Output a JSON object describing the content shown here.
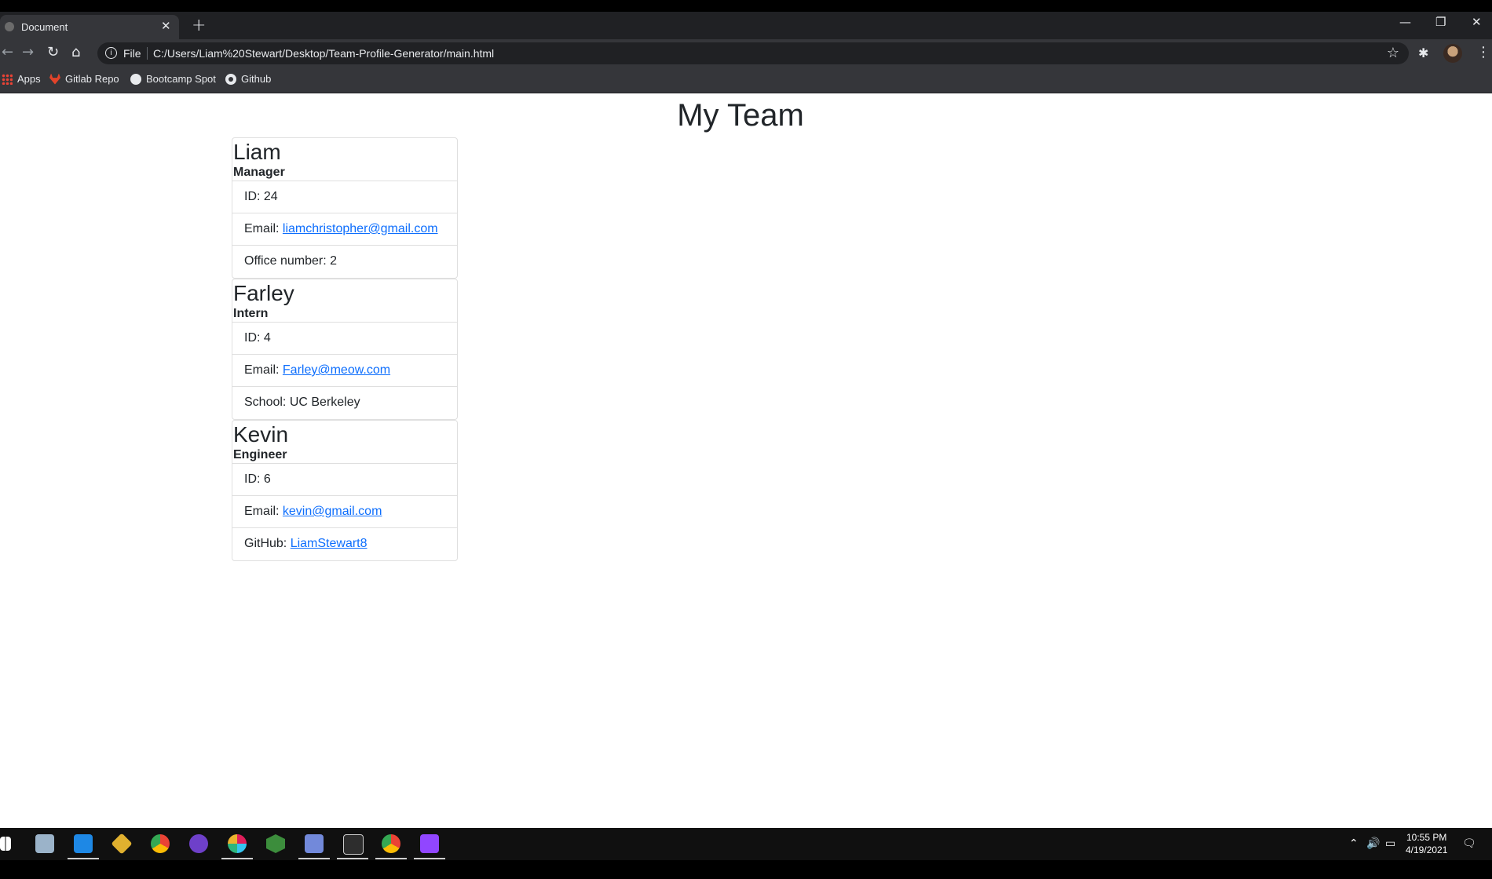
{
  "browser": {
    "tab_title": "Document",
    "close_glyph": "✕",
    "new_tab_glyph": "+",
    "url_scheme": "File",
    "url": "C:/Users/Liam%20Stewart/Desktop/Team-Profile-Generator/main.html",
    "bookmarks": [
      {
        "label": "Apps",
        "icon": "apps-icon"
      },
      {
        "label": "Gitlab Repo",
        "icon": "gitlab-icon"
      },
      {
        "label": "Bootcamp Spot",
        "icon": "globe-icon"
      },
      {
        "label": "Github",
        "icon": "github-icon"
      }
    ]
  },
  "page": {
    "title": "My Team",
    "members": [
      {
        "name": "Liam",
        "role": "Manager",
        "id_label": "ID: 24",
        "email_prefix": "Email: ",
        "email": "liamchristopher@gmail.com",
        "extra_prefix": "Office number: 2",
        "extra_link": ""
      },
      {
        "name": "Farley",
        "role": "Intern",
        "id_label": "ID: 4",
        "email_prefix": "Email: ",
        "email": "Farley@meow.com",
        "extra_prefix": "School: UC Berkeley",
        "extra_link": ""
      },
      {
        "name": "Kevin",
        "role": "Engineer",
        "id_label": "ID: 6",
        "email_prefix": "Email: ",
        "email": "kevin@gmail.com",
        "extra_prefix": "GitHub: ",
        "extra_link": "LiamStewart8"
      }
    ]
  },
  "taskbar": {
    "time": "10:55 PM",
    "date": "4/19/2021"
  },
  "colors": {
    "link": "#0d6efd",
    "chrome_dark": "#202124",
    "chrome_toolbar": "#35363a"
  }
}
